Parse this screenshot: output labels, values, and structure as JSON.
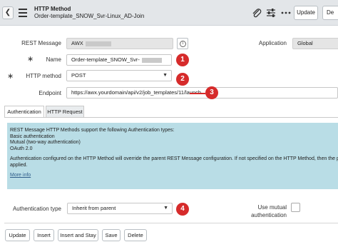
{
  "header": {
    "record_type": "HTTP Method",
    "record_name": "Order-template_SNOW_Svr-Linux_AD-Join",
    "back_icon": "chevron-left-icon",
    "menu_icon": "hamburger-menu-icon",
    "attachment_icon": "paperclip-icon",
    "settings_icon": "sliders-icon",
    "more_icon": "more-dots-icon",
    "update_label": "Update",
    "delete_label": "De"
  },
  "form": {
    "rest_message": {
      "label": "REST Message",
      "value": "AWX"
    },
    "application": {
      "label": "Application",
      "value": "Global"
    },
    "name": {
      "label": "Name",
      "value": "Order-template_SNOW_Svr-"
    },
    "http_method": {
      "label": "HTTP method",
      "value": "POST"
    },
    "endpoint": {
      "label": "Endpoint",
      "value": "https://awx.yourdomain/api/v2/job_templates/11/launch"
    },
    "required_marker": "∗"
  },
  "callouts": [
    "1",
    "2",
    "3",
    "4"
  ],
  "tabs": [
    {
      "label": "Authentication",
      "active": true
    },
    {
      "label": "HTTP Request",
      "active": false
    }
  ],
  "notice": {
    "line1": "REST Message HTTP Methods support the following Authentication types:",
    "line2": "Basic authentication",
    "line3": "Mutual (two-way authentication)",
    "line4": "OAuth 2.0",
    "line5": "Authentication configured on the HTTP Method will override the parent REST Message configuration. If not specified on the HTTP Method, then the p",
    "line6": "applied.",
    "more": "More info"
  },
  "auth": {
    "type_label": "Authentication type",
    "type_value": "Inherit from parent",
    "mutual_label_1": "Use mutual",
    "mutual_label_2": "authentication"
  },
  "footer": {
    "buttons": [
      "Update",
      "Insert",
      "Insert and Stay",
      "Save",
      "Delete"
    ]
  },
  "colors": {
    "callout": "#d62b2b",
    "notice_bg": "#b9dde6",
    "header_bg": "#e3e6e9"
  }
}
